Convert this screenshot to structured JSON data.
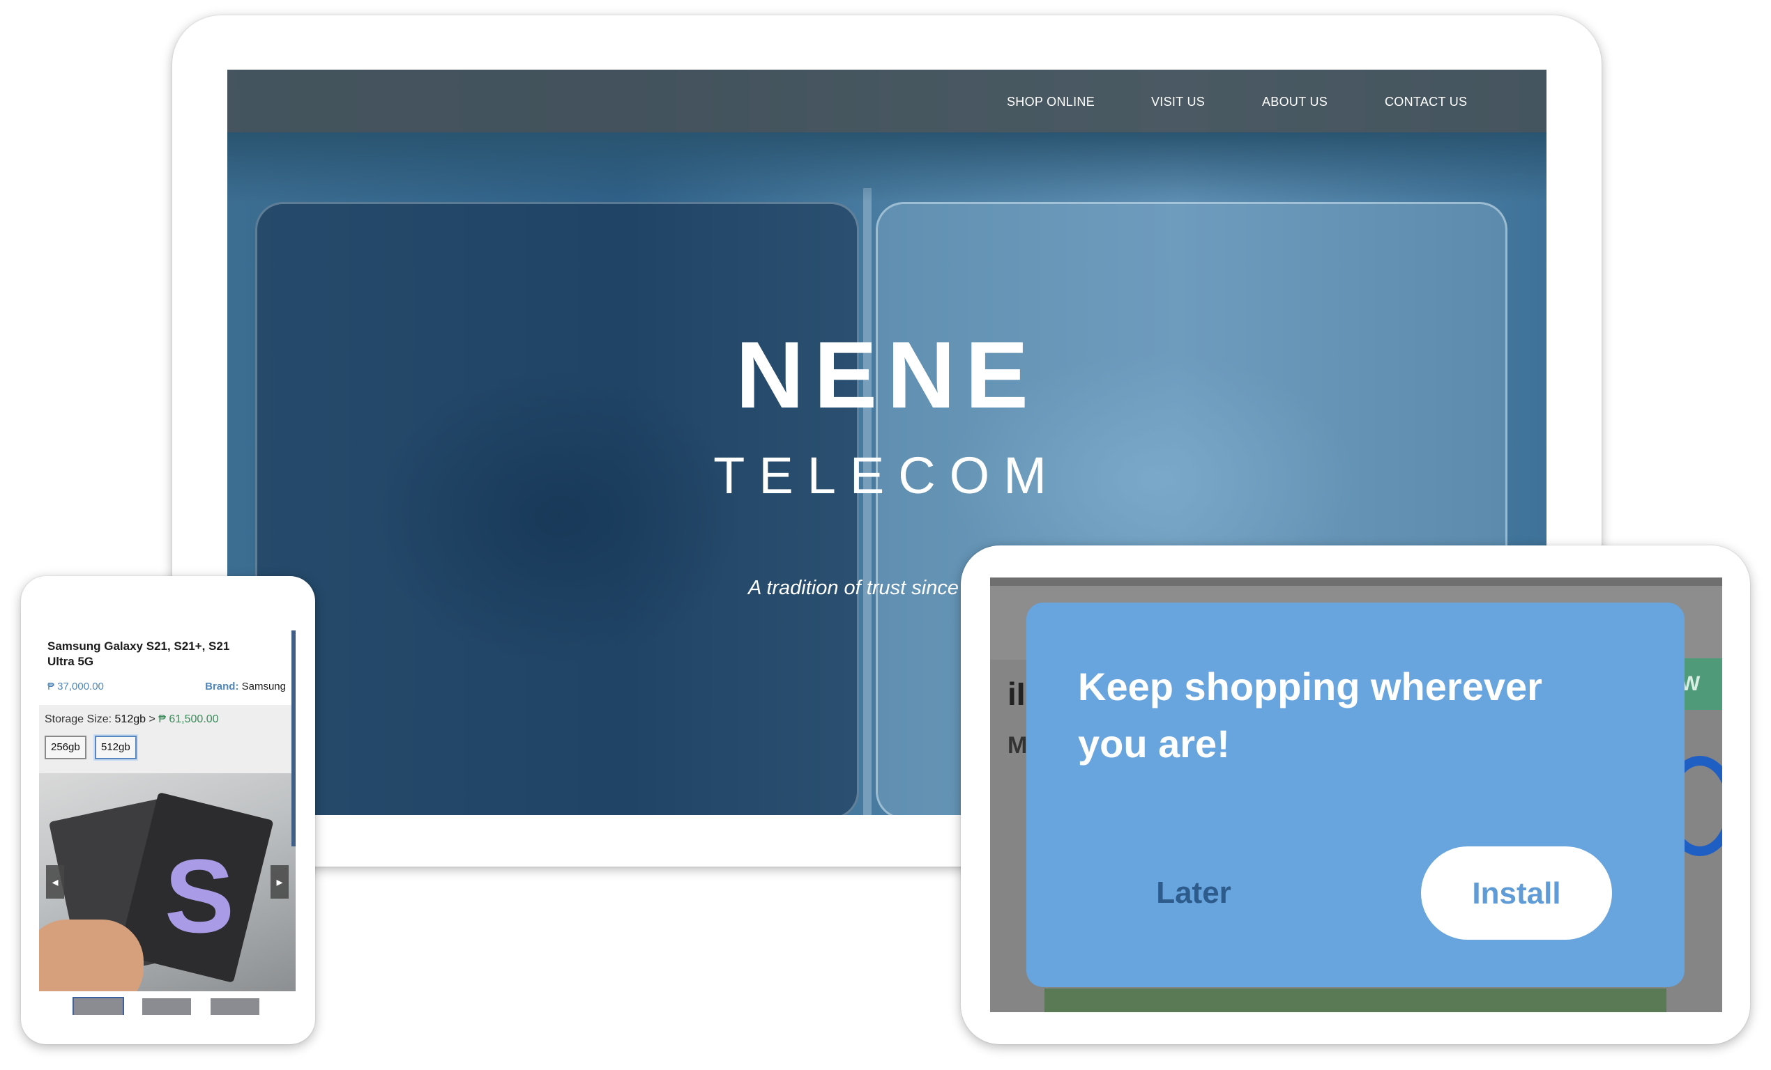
{
  "desktop": {
    "nav": [
      "SHOP ONLINE",
      "VISIT US",
      "ABOUT US",
      "CONTACT US"
    ],
    "brand_main": "NENE",
    "brand_sub": "TELECOM",
    "tagline": "A tradition of trust since"
  },
  "phone": {
    "product_title": "Samsung Galaxy S21, S21+, S21 Ultra 5G",
    "price": "₱ 37,000.00",
    "brand_label": "Brand:",
    "brand_value": "Samsung",
    "storage_label": "Storage Size:",
    "storage_value": "512gb",
    "storage_sep": ">",
    "storage_price": "₱ 61,500.00",
    "options": [
      "256gb",
      "512gb"
    ],
    "photo_glyph": "S",
    "arrow_left": "◂",
    "arrow_right": "▸"
  },
  "tablet": {
    "bg_text_1": "iI",
    "bg_text_2": "M",
    "bg_text_3": "W",
    "popup_title": "Keep shopping wherever you are!",
    "later_label": "Later",
    "install_label": "Install"
  },
  "colors": {
    "popup_bg": "#68a4de",
    "install_text": "#5f9bd6",
    "later_text": "#2d5b8b",
    "price_blue": "#4f86b8",
    "price_green": "#3a8a5a"
  }
}
